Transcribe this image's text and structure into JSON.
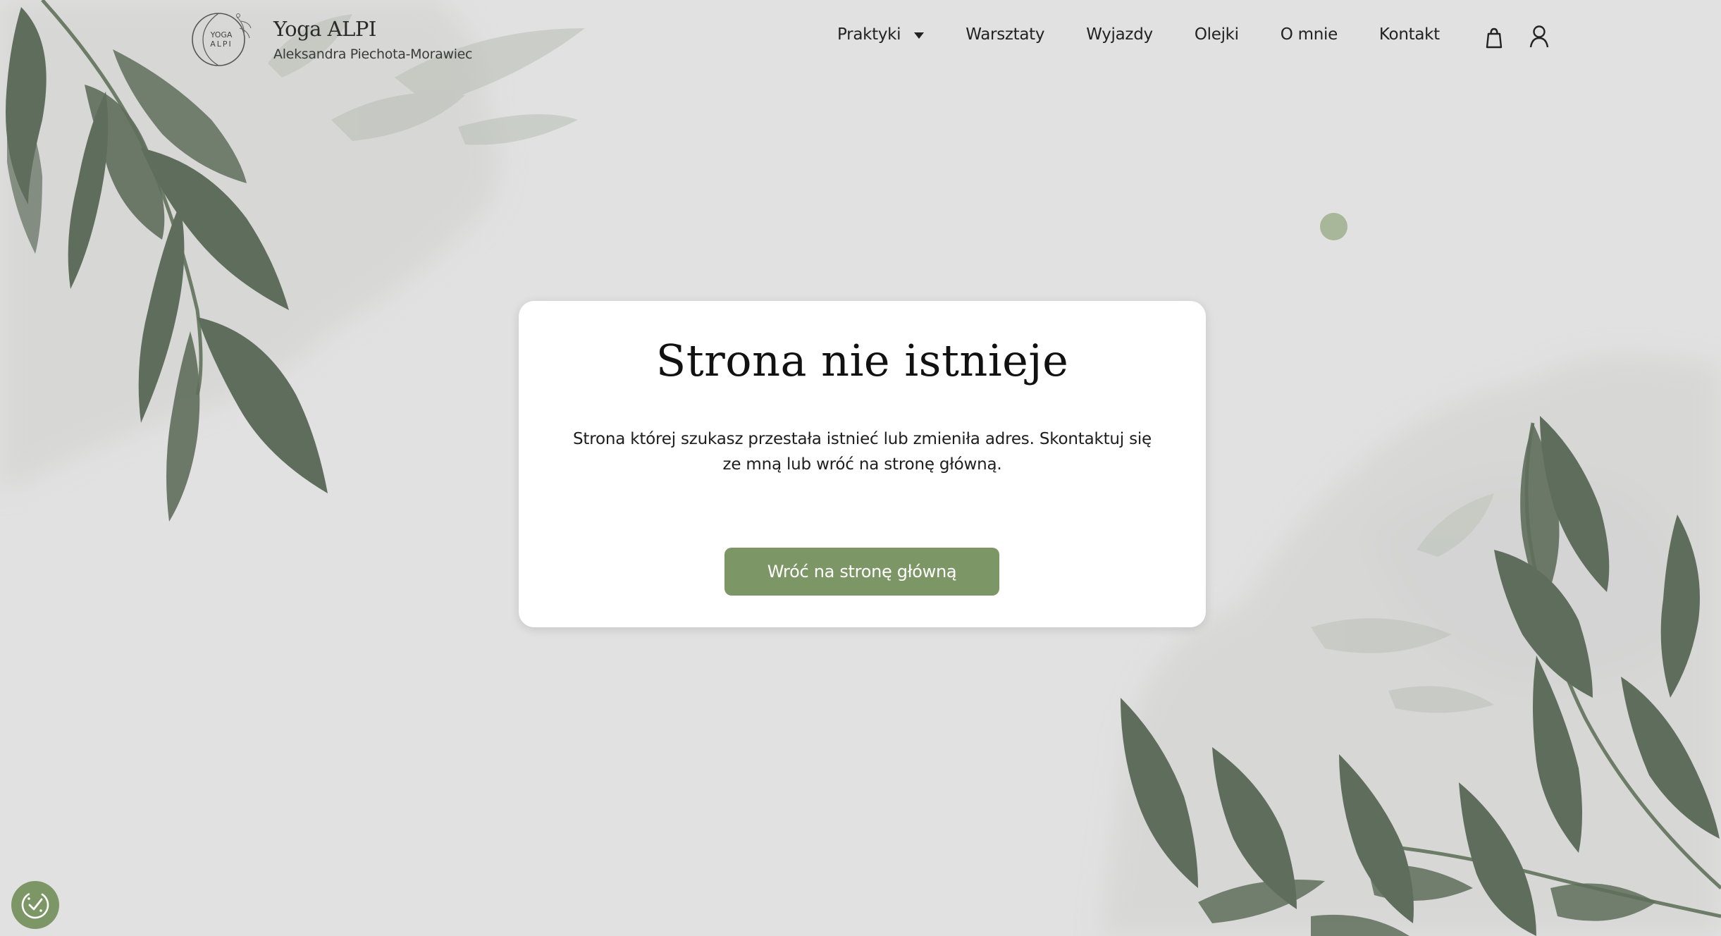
{
  "brand": {
    "logo_text_line1": "YOGA",
    "logo_text_line2": "ALPI",
    "name": "Yoga ALPI",
    "subtitle": "Aleksandra Piechota-Morawiec"
  },
  "nav": {
    "items": [
      {
        "label": "Praktyki",
        "has_dropdown": true
      },
      {
        "label": "Warsztaty"
      },
      {
        "label": "Wyjazdy"
      },
      {
        "label": "Olejki"
      },
      {
        "label": "O mnie"
      },
      {
        "label": "Kontakt"
      }
    ],
    "icons": [
      "shopping-bag-icon",
      "user-icon"
    ]
  },
  "error_card": {
    "title": "Strona nie istnieje",
    "message_line1": "Strona której szukasz przestała istnieć lub zmieniła adres. Skontaktuj się",
    "message_line2": "ze mną lub wróć na stronę główną.",
    "button_label": "Wróć na stronę główną"
  },
  "consent": {
    "icon": "cookie-consent-icon"
  },
  "colors": {
    "background": "#e1e1e1",
    "accent_green": "#7d9666",
    "dot_green": "#a8b79a",
    "leaf_dark": "#5f6e5c",
    "card_bg": "#ffffff"
  }
}
